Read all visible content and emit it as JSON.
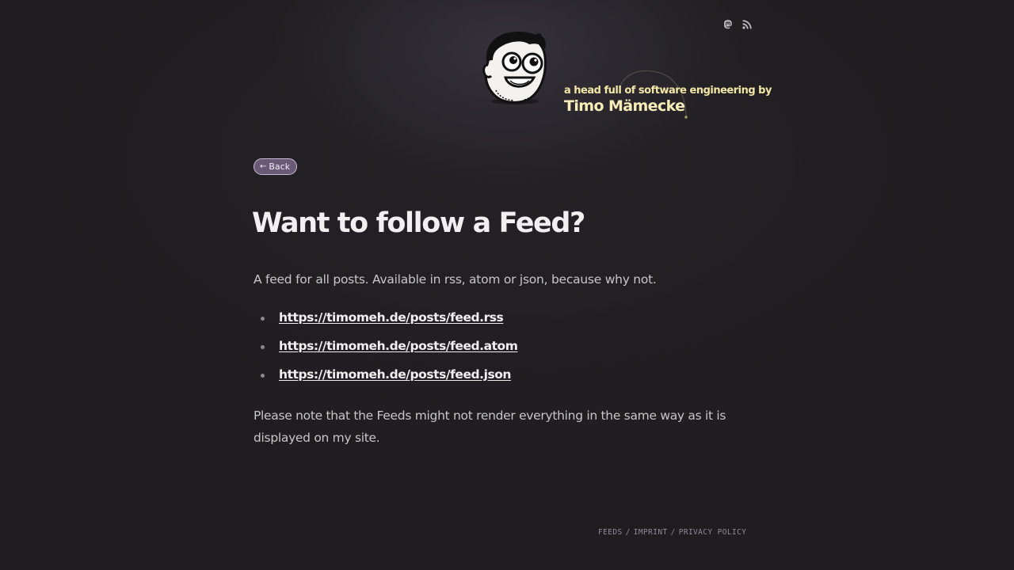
{
  "header": {
    "tagline": "a head full of software engineering by",
    "owner_name": "Timo Mämecke",
    "icons": [
      "mastodon-icon",
      "rss-icon"
    ]
  },
  "nav": {
    "back_label": "Back",
    "back_icon": "arrow-left-icon"
  },
  "main": {
    "title": "Want to follow a Feed?",
    "intro": "A feed for all posts. Available in rss, atom or json, because why not.",
    "feeds": [
      "https://timomeh.de/posts/feed.rss",
      "https://timomeh.de/posts/feed.atom",
      "https://timomeh.de/posts/feed.json"
    ],
    "note": "Please note that the Feeds might not render everything in the same way as it is displayed on my site."
  },
  "footer": {
    "links": [
      "FEEDS",
      "IMPRINT",
      "PRIVACY POLICY"
    ],
    "separator": "/"
  },
  "colors": {
    "background": "#1f1d20",
    "tagline": "#f3e6a6",
    "back_button_bg": "#6a5a78",
    "title": "#f2eff3"
  }
}
